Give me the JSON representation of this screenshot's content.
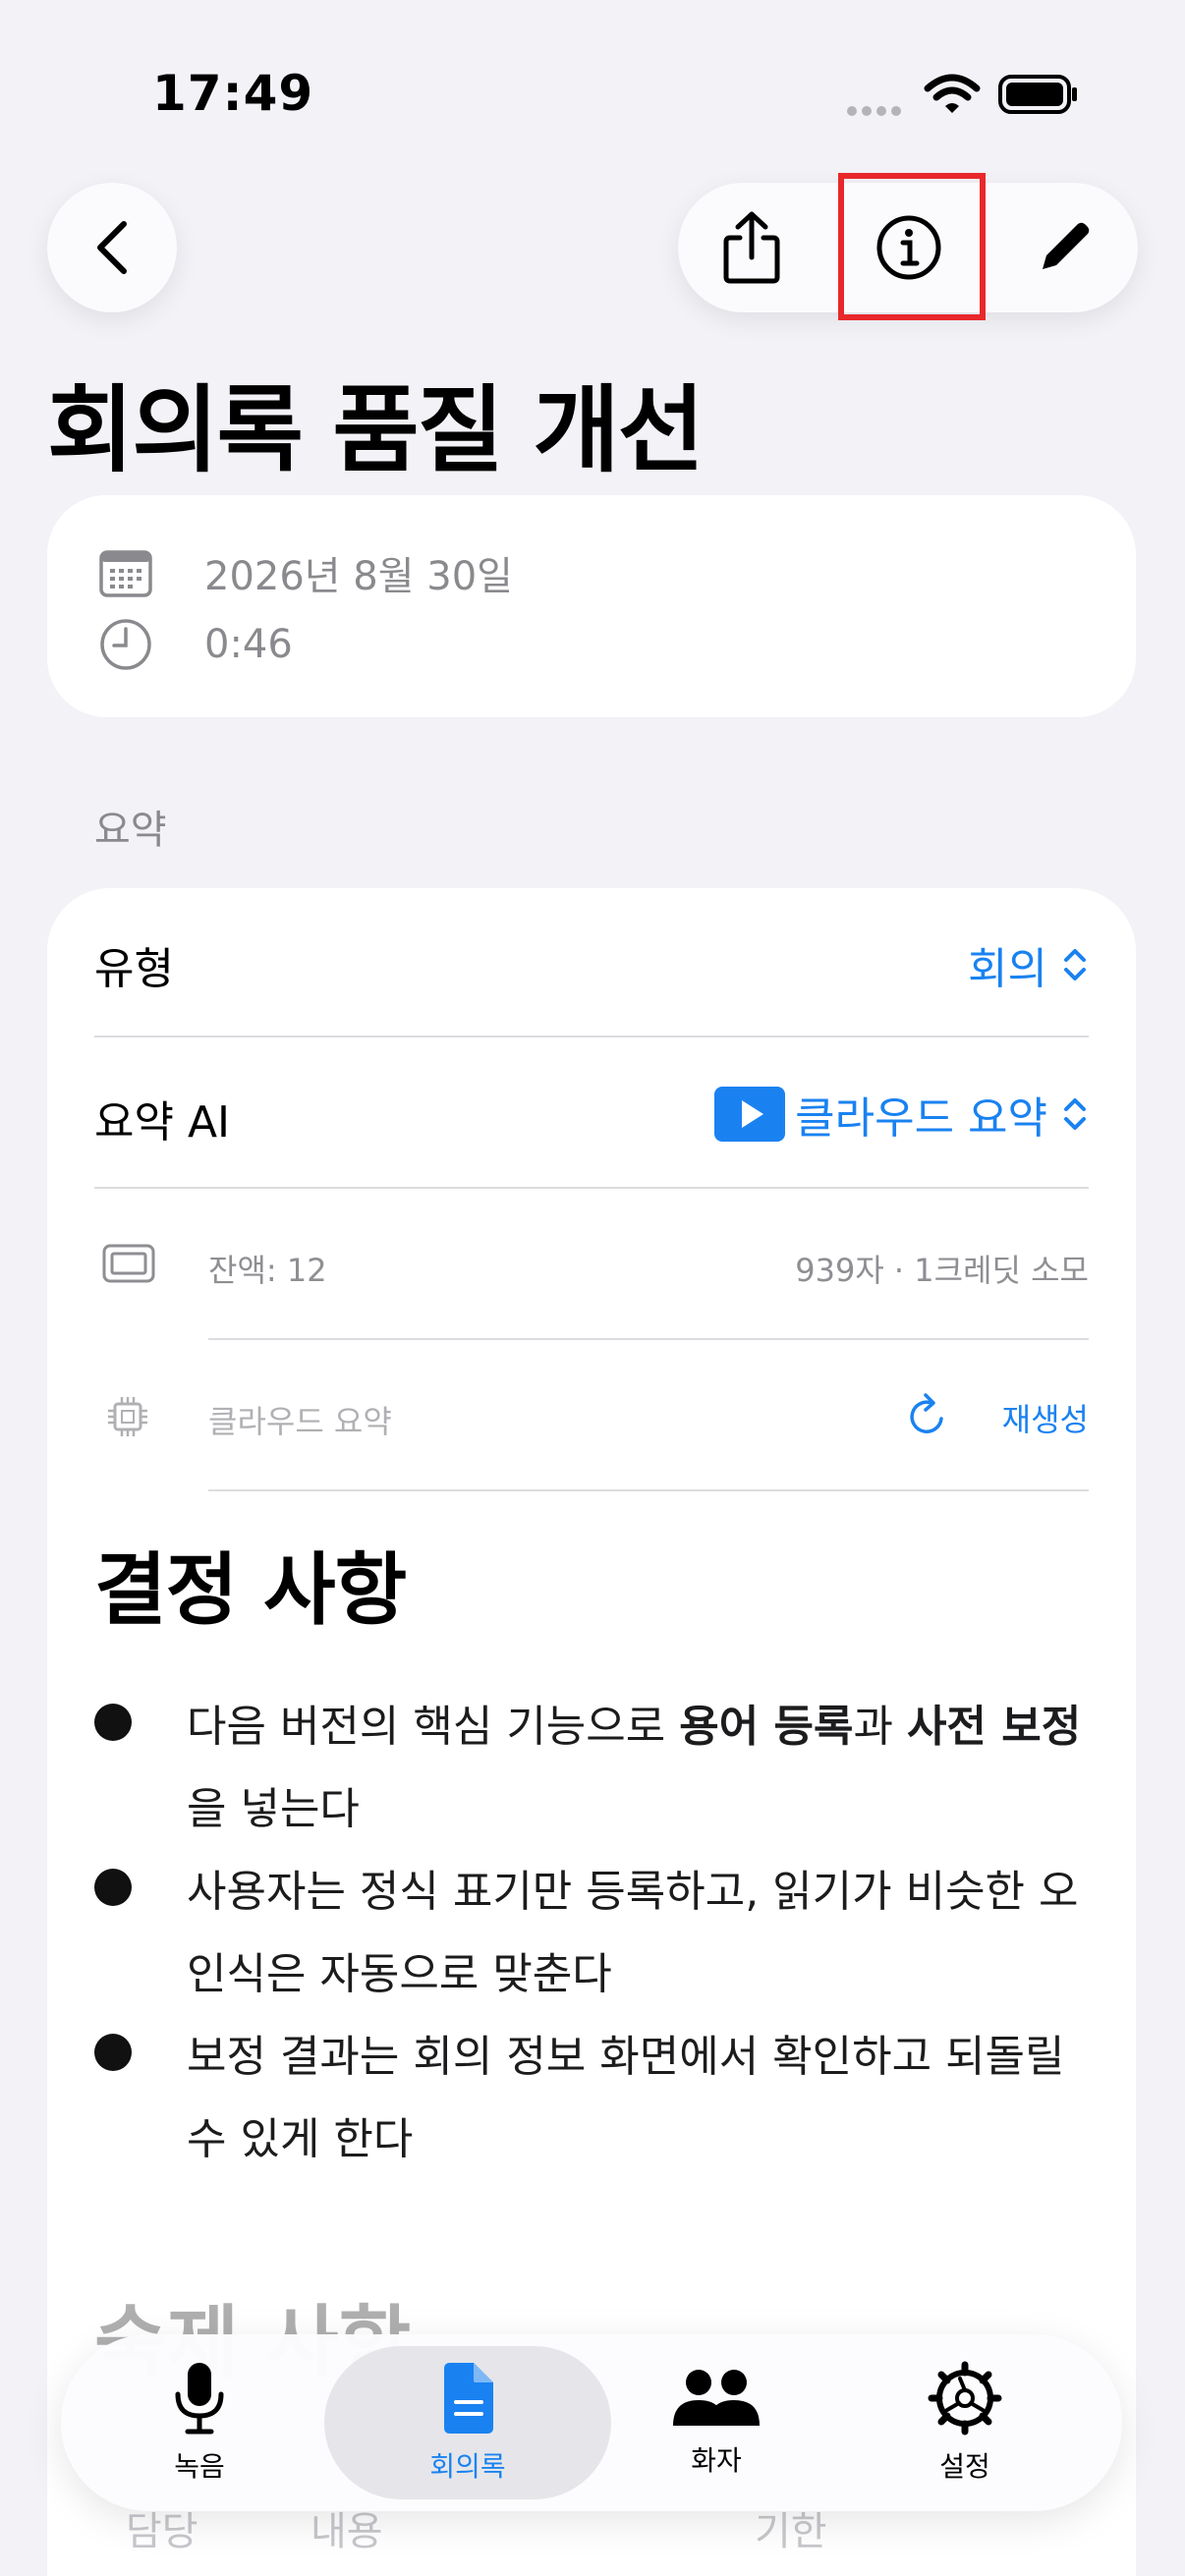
{
  "status_bar": {
    "time": "17:49"
  },
  "page": {
    "title": "회의록 품질 개선"
  },
  "meta": {
    "date": "2026년 8월 30일",
    "duration": "0:46"
  },
  "summary": {
    "section_label": "요약",
    "type_label": "유형",
    "type_value": "회의",
    "ai_label": "요약 AI",
    "ai_value": "클라우드 요약",
    "balance": "잔액: 12",
    "usage": "939자 · 1크레딧 소모",
    "engine_placeholder": "클라우드 요약",
    "regenerate_label": "재생성"
  },
  "content": {
    "decisions_heading": "결정 사항",
    "bullets": [
      {
        "pre": "다음 버전의 핵심 기능으로 ",
        "b1": "용어 등록",
        "mid": "과 ",
        "b2": "사전 보정",
        "post": "을 넣는다"
      },
      {
        "text": "사용자는 정식 표기만 등록하고, 읽기가 비슷한 오인식은 자동으로 맞춘다"
      },
      {
        "text": "보정 결과는 회의 정보 화면에서 확인하고 되돌릴 수 있게 한다"
      }
    ],
    "action_heading": "숙제 사항",
    "table_headers": [
      "담당",
      "내용",
      "기한"
    ]
  },
  "tabs": [
    {
      "label": "녹음",
      "icon": "mic-icon"
    },
    {
      "label": "회의록",
      "icon": "document-icon",
      "active": true
    },
    {
      "label": "화자",
      "icon": "people-icon"
    },
    {
      "label": "설정",
      "icon": "gear-icon"
    }
  ],
  "colors": {
    "accent": "#1a82f0",
    "highlight": "#e8282b",
    "background": "#f2f2f7"
  }
}
